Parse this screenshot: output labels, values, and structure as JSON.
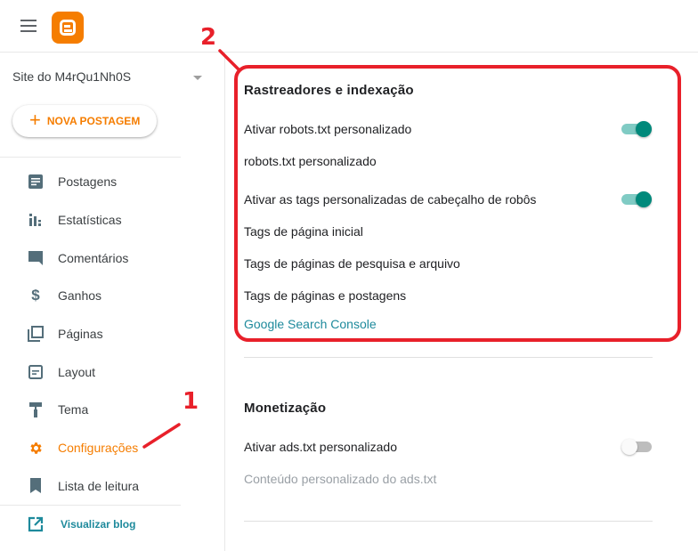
{
  "app": {
    "name": "Blogger",
    "brand_color": "#f57d00",
    "accent_color": "#00897b",
    "link_color": "#1e8a9c"
  },
  "topbar": {
    "menu_icon": "hamburger-menu-icon",
    "logo_icon": "blogger-logo-icon"
  },
  "sidebar": {
    "blog_name": "Site do M4rQu1Nh0S",
    "new_post_label": "NOVA POSTAGEM",
    "items": [
      {
        "label": "Postagens",
        "icon": "document-icon"
      },
      {
        "label": "Estatísticas",
        "icon": "bar-chart-icon"
      },
      {
        "label": "Comentários",
        "icon": "comment-icon"
      },
      {
        "label": "Ganhos",
        "icon": "dollar-icon"
      },
      {
        "label": "Páginas",
        "icon": "pages-icon"
      },
      {
        "label": "Layout",
        "icon": "layout-icon"
      },
      {
        "label": "Tema",
        "icon": "paint-roller-icon"
      },
      {
        "label": "Configurações",
        "icon": "gear-icon",
        "active": true
      },
      {
        "label": "Lista de leitura",
        "icon": "bookmark-icon"
      }
    ],
    "view_blog_label": "Visualizar blog"
  },
  "main": {
    "crawlers": {
      "title": "Rastreadores e indexação",
      "enable_robots_label": "Ativar robots.txt personalizado",
      "enable_robots_on": true,
      "robots_label": "robots.txt personalizado",
      "enable_robot_tags_label": "Ativar as tags personalizadas de cabeçalho de robôs",
      "enable_robot_tags_on": true,
      "home_tags_label": "Tags de página inicial",
      "search_archive_tags_label": "Tags de páginas de pesquisa e arquivo",
      "page_post_tags_label": "Tags de páginas e postagens",
      "search_console_link": "Google Search Console"
    },
    "monetization": {
      "title": "Monetização",
      "enable_ads_label": "Ativar ads.txt personalizado",
      "enable_ads_on": false,
      "ads_content_label": "Conteúdo personalizado do ads.txt"
    }
  },
  "annotations": {
    "marker_1": "1",
    "marker_2": "2",
    "color": "#e8202a"
  }
}
